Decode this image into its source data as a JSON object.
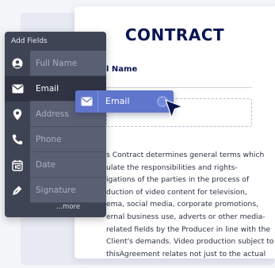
{
  "document": {
    "title": "CONTRACT",
    "field_label": "l Name",
    "body_lines": [
      "s Contract determines general terms which",
      "ulate the responsibilities and rights-",
      "igations of the parties in the process of",
      "duction of video content for television,",
      "ema, social media, corporate promotions,",
      "ernal business use, adverts or other media-",
      "related fields by the Producer in line with the",
      "Client's demands. Video production subject to",
      "thisAgreement relates not just to the actual"
    ]
  },
  "fields_panel": {
    "header": "Add Fields",
    "items": [
      {
        "label": "Full Name",
        "icon": "user-icon"
      },
      {
        "label": "Email",
        "icon": "envelope-icon"
      },
      {
        "label": "Address",
        "icon": "map-pin-icon"
      },
      {
        "label": "Phone",
        "icon": "phone-icon"
      },
      {
        "label": "Date",
        "icon": "calendar-icon"
      },
      {
        "label": "Signature",
        "icon": "pen-icon"
      }
    ],
    "more": "...more"
  },
  "drag_item": {
    "label": "Email",
    "icon": "envelope-icon"
  },
  "colors": {
    "title": "#0a1551",
    "panel": "#3f4455",
    "active_row": "#2f3342",
    "drag_item": "#5f76cc",
    "cursor": "#0a1551"
  }
}
